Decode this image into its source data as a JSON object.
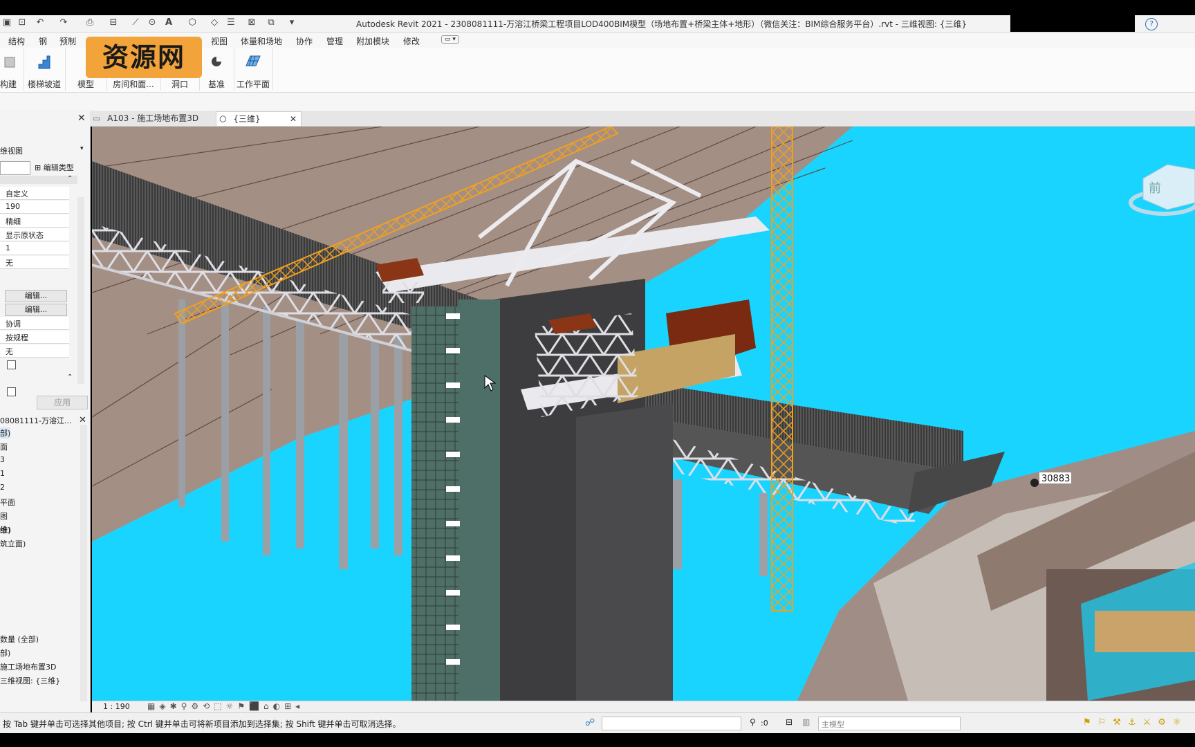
{
  "window": {
    "title": "Autodesk Revit 2021 - 2308081111-万溶江桥梁工程项目LOD400BIM模型（场地布置+桥梁主体+地形）（微信关注：BIM综合服务平台）.rvt - 三维视图: {三维}",
    "help": "?"
  },
  "watermark": "资源网",
  "menu": [
    "结构",
    "钢",
    "预制",
    "视图",
    "体量和场地",
    "协作",
    "管理",
    "附加模块",
    "修改"
  ],
  "ribbon": {
    "buttons": [
      "构建",
      "楼梯坡道",
      "模型",
      "房间和面...",
      "洞口",
      "基准",
      "工作平面"
    ]
  },
  "properties": {
    "view_type": "维视图",
    "edit_type": "编辑类型",
    "rows": [
      "自定义",
      "190",
      "精细",
      "显示原状态",
      "1",
      "无"
    ],
    "edit_buttons": [
      "编辑...",
      "编辑..."
    ],
    "rows2": [
      "协调",
      "按规程",
      "无"
    ],
    "apply": "应用"
  },
  "browser": {
    "title": "08081111-万溶江...",
    "items": [
      "部)",
      "面",
      "3",
      "1",
      "2",
      "平面",
      "图",
      "维)",
      "筑立面)",
      "数量 (全部)",
      "部)",
      "施工场地布置3D",
      "三维视图: {三维}"
    ]
  },
  "view_tabs": [
    {
      "label": "A103 - 施工场地布置3D"
    },
    {
      "label": "{三维}"
    }
  ],
  "viewport": {
    "viewcube_label": "前",
    "dimension_label": "30883"
  },
  "view_control": {
    "scale": "1 : 190"
  },
  "status": {
    "message": "按 Tab 键并单击可选择其他项目; 按 Ctrl 键并单击可将新项目添加到选择集; 按 Shift 键并单击可取消选择。",
    "selection_count": ":0",
    "model": "主模型"
  },
  "colors": {
    "water": "#19d4ff",
    "terrain": "#a48f84",
    "crane": "#f0a020",
    "steel": "#d8d8dc"
  }
}
